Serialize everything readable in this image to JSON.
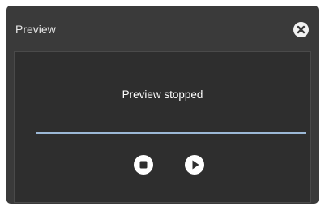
{
  "window": {
    "title": "Preview"
  },
  "preview": {
    "status_text": "Preview stopped",
    "progress": 1.0
  },
  "controls": {
    "close_icon": "close-circle-icon",
    "stop_icon": "stop-icon",
    "play_icon": "play-icon"
  },
  "colors": {
    "dialog_bg": "#3a3a3a",
    "content_bg": "#2e2e2e",
    "progress": "#9cb8d6",
    "button": "#ffffff"
  }
}
